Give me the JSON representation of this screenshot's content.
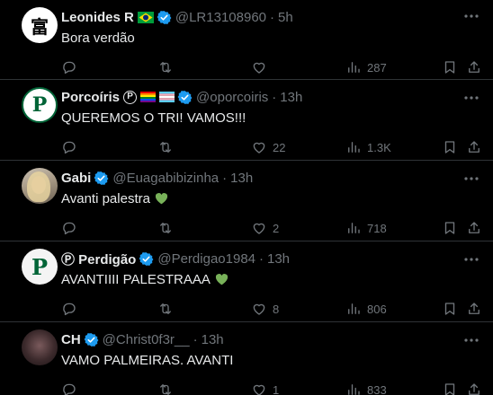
{
  "tweets": [
    {
      "name": "Leonides R",
      "handle": "@LR13108960",
      "time": "5h",
      "text": "Bora verdão",
      "reply": "",
      "retweet": "",
      "like": "",
      "views": "287",
      "avatar_glyph": "富",
      "flag": "brazil"
    },
    {
      "name": "Porcoíris",
      "handle": "@oporcoiris",
      "time": "13h",
      "text": "QUEREMOS O TRI! VAMOS!!!",
      "reply": "",
      "retweet": "",
      "like": "22",
      "views": "1.3K",
      "avatar_glyph": "P",
      "flag": "rainbow-and-trans"
    },
    {
      "name": "Gabi",
      "handle": "@Euagabibizinha",
      "time": "13h",
      "text": "Avanti palestra",
      "reply": "",
      "retweet": "",
      "like": "2",
      "views": "718",
      "avatar_glyph": "",
      "flag": ""
    },
    {
      "name": "Ⓟ Perdigão",
      "handle": "@Perdigao1984",
      "time": "13h",
      "text": "AVANTIIII PALESTRAAA",
      "reply": "",
      "retweet": "",
      "like": "8",
      "views": "806",
      "avatar_glyph": "P",
      "flag": ""
    },
    {
      "name": "CH",
      "handle": "@Christ0f3r__",
      "time": "13h",
      "text": "VAMO PALMEIRAS. AVANTI",
      "reply": "",
      "retweet": "",
      "like": "1",
      "views": "833",
      "avatar_glyph": "",
      "flag": ""
    }
  ],
  "colors": {
    "background": "#000000",
    "text": "#e7e9ea",
    "muted": "#71767b",
    "verified": "#1d9bf0",
    "divider": "#2f3336",
    "palmeiras_green": "#006437",
    "green_heart": "#78b159"
  },
  "icons": [
    "verified-badge-icon",
    "more-icon",
    "reply-icon",
    "retweet-icon",
    "like-icon",
    "views-icon",
    "bookmark-icon",
    "share-icon",
    "green-heart-emoji-icon"
  ]
}
